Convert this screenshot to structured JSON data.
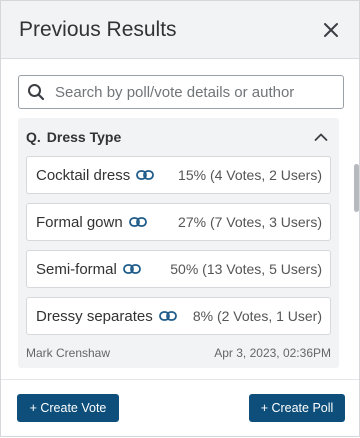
{
  "header": {
    "title": "Previous Results"
  },
  "search": {
    "placeholder": "Search by poll/vote details or author"
  },
  "question": {
    "prefix": "Q.",
    "title": "Dress Type",
    "options": [
      {
        "label": "Cocktail dress",
        "stat": "15% (4 Votes, 2 Users)"
      },
      {
        "label": "Formal gown",
        "stat": "27% (7 Votes, 3 Users)"
      },
      {
        "label": "Semi-formal",
        "stat": "50% (13 Votes, 5 Users)"
      },
      {
        "label": "Dressy separates",
        "stat": "8% (2 Votes, 1 User)"
      }
    ],
    "author": "Mark Crenshaw",
    "timestamp": "Apr 3, 2023, 02:36PM"
  },
  "footer": {
    "create_vote_label": "+ Create Vote",
    "create_poll_label": "+ Create Poll"
  },
  "colors": {
    "primary": "#0d4f7a",
    "link_icon": "#1f5c8a",
    "panel_bg": "#f2f3f5"
  },
  "icons": {
    "search": "search-icon",
    "close": "close-icon",
    "collapse": "chevron-up-icon",
    "link": "link-icon"
  }
}
